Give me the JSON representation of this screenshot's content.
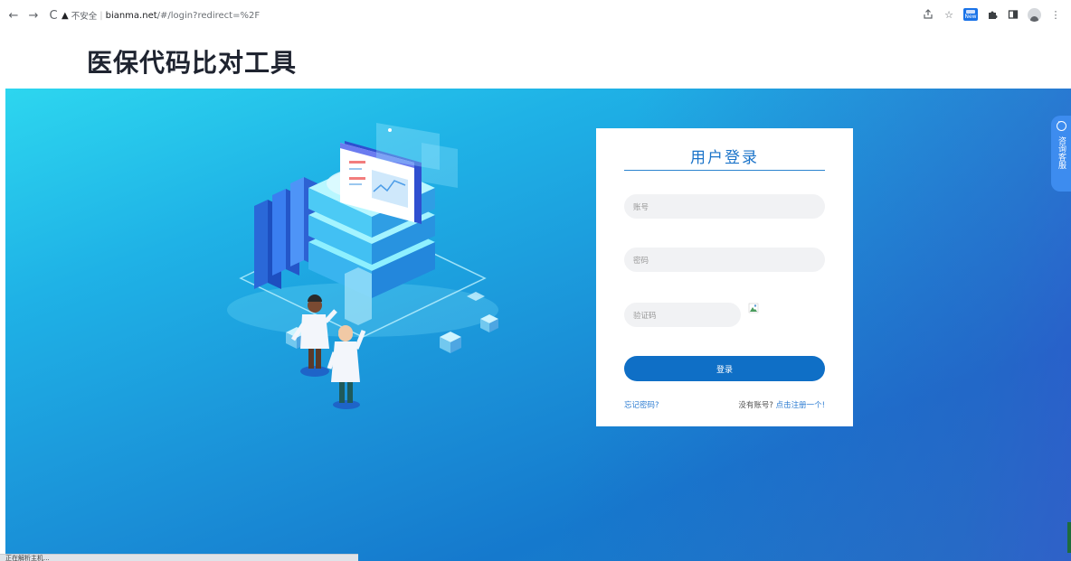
{
  "browser": {
    "back": "←",
    "forward": "→",
    "reload": "C",
    "warning_icon": "▲",
    "insecure_label": "不安全",
    "separator": "|",
    "url_host": "bianma.net",
    "url_path": "/#/login?redirect=%2F",
    "new_badge": "New"
  },
  "header": {
    "title": "医保代码比对工具"
  },
  "login": {
    "title": "用户登录",
    "account_placeholder": "账号",
    "password_placeholder": "密码",
    "captcha_placeholder": "验证码",
    "submit_label": "登录",
    "forgot_label": "忘记密码?",
    "no_account_label": "没有账号?",
    "register_label": "点击注册一个!"
  },
  "consult": {
    "label": "咨询客服"
  },
  "status": {
    "text": "正在解析主机..."
  },
  "colors": {
    "accent": "#0f6fc6",
    "link": "#2b7bd2",
    "title_blue": "#1a73c9",
    "hero_start": "#2dd6ef",
    "hero_end": "#1579cd"
  }
}
